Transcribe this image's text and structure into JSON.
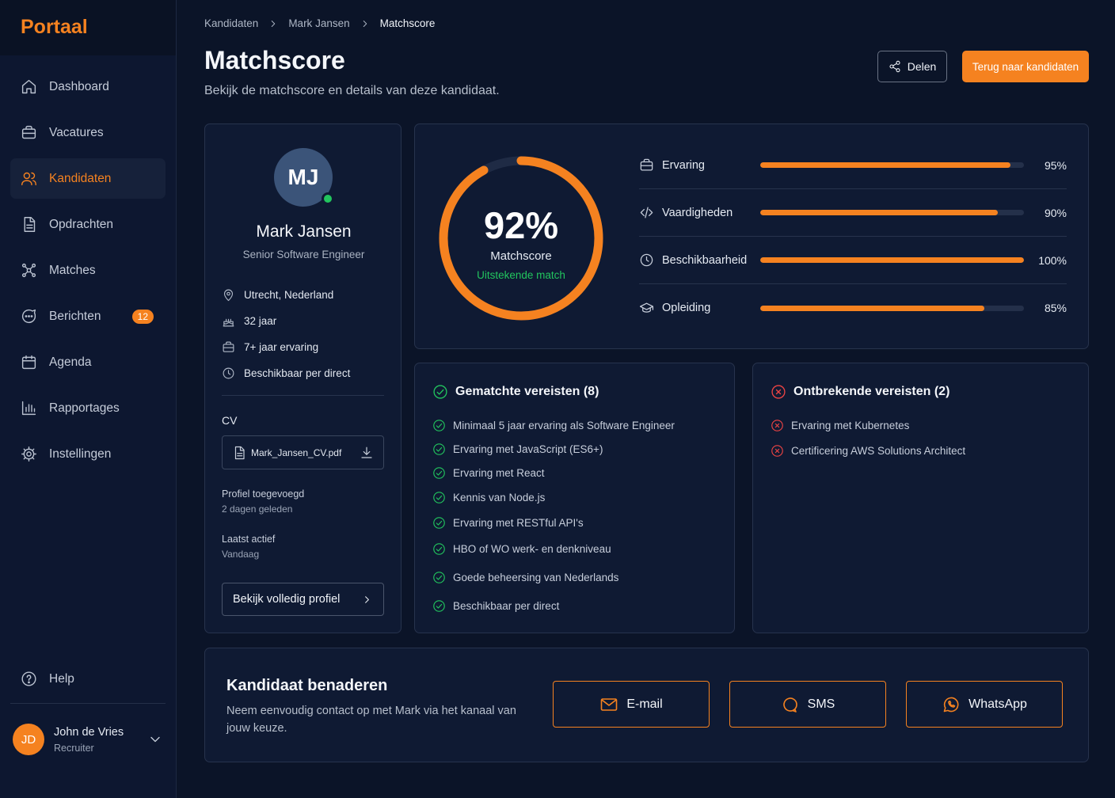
{
  "app": {
    "logo": "Portaal"
  },
  "sidebar": {
    "items": [
      {
        "label": "Dashboard",
        "icon": "home-icon"
      },
      {
        "label": "Vacatures",
        "icon": "briefcase-icon"
      },
      {
        "label": "Kandidaten",
        "icon": "users-icon",
        "active": true
      },
      {
        "label": "Opdrachten",
        "icon": "document-icon"
      },
      {
        "label": "Matches",
        "icon": "network-icon"
      },
      {
        "label": "Berichten",
        "icon": "chat-icon",
        "badge": "12"
      },
      {
        "label": "Agenda",
        "icon": "calendar-icon"
      },
      {
        "label": "Rapportages",
        "icon": "bar-chart-icon"
      },
      {
        "label": "Instellingen",
        "icon": "gear-icon"
      }
    ],
    "help": "Help",
    "user": {
      "initials": "JD",
      "name": "John de Vries",
      "role": "Recruiter"
    }
  },
  "breadcrumb": [
    "Kandidaten",
    "Mark Jansen",
    "Matchscore"
  ],
  "page": {
    "title": "Matchscore",
    "subtitle": "Bekijk de matchscore en details van deze kandidaat.",
    "share_label": "Delen",
    "back_label": "Terug naar kandidaten"
  },
  "candidate": {
    "initials": "MJ",
    "name": "Mark Jansen",
    "role": "Senior Software Engineer",
    "location": "Utrecht, Nederland",
    "age": "32 jaar",
    "experience": "7+ jaar ervaring",
    "availability": "Beschikbaar per direct",
    "cv_label": "CV",
    "cv_file": "Mark_Jansen_CV.pdf",
    "added_label": "Profiel toegevoegd",
    "added_value": "2 dagen geleden",
    "active_label": "Laatst actief",
    "active_value": "Vandaag",
    "profile_button": "Bekijk volledig profiel"
  },
  "score": {
    "percent": 92,
    "percent_label": "92%",
    "label": "Matchscore",
    "sub": "Uitstekende match",
    "metrics": [
      {
        "label": "Ervaring",
        "value": 95,
        "display": "95%",
        "icon": "briefcase-icon"
      },
      {
        "label": "Vaardigheden",
        "value": 90,
        "display": "90%",
        "icon": "code-icon"
      },
      {
        "label": "Beschikbaarheid",
        "value": 100,
        "display": "100%",
        "icon": "clock-icon"
      },
      {
        "label": "Opleiding",
        "value": 85,
        "display": "85%",
        "icon": "graduation-cap-icon"
      }
    ]
  },
  "matched": {
    "title": "Gematchte vereisten (8)",
    "items": [
      "Minimaal 5 jaar ervaring als Software Engineer",
      "Ervaring met JavaScript (ES6+)",
      "Ervaring met React",
      "Kennis van Node.js",
      "Ervaring met RESTful API's",
      "HBO of WO werk- en denkniveau",
      "Goede beheersing van Nederlands",
      "Beschikbaar per direct"
    ]
  },
  "missing": {
    "title": "Ontbrekende vereisten (2)",
    "items": [
      "Ervaring met Kubernetes",
      "Certificering AWS Solutions Architect"
    ]
  },
  "contact": {
    "title": "Kandidaat benaderen",
    "text": "Neem eenvoudig contact op met Mark via het kanaal van jouw keuze.",
    "email": "E-mail",
    "sms": "SMS",
    "whatsapp": "WhatsApp"
  },
  "colors": {
    "accent": "#f58220",
    "background": "#0b1428",
    "card": "#0f1a33",
    "success": "#22c55e",
    "danger": "#ef4444"
  }
}
